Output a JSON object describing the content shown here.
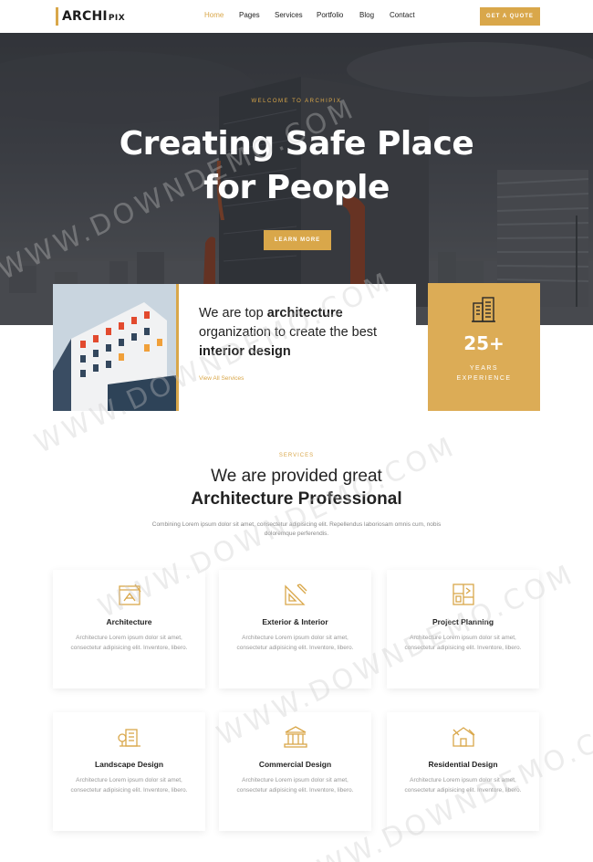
{
  "brand": {
    "name_main": "ARCHI",
    "name_sub": "PIX"
  },
  "nav": {
    "items": [
      {
        "label": "Home",
        "active": true
      },
      {
        "label": "Pages",
        "active": false
      },
      {
        "label": "Services",
        "active": false
      },
      {
        "label": "Portfolio",
        "active": false
      },
      {
        "label": "Blog",
        "active": false
      },
      {
        "label": "Contact",
        "active": false
      }
    ],
    "cta_label": "GET A QUOTE"
  },
  "hero": {
    "kicker": "WELCOME TO ARCHIPIX",
    "title_line1": "Creating Safe Place",
    "title_line2": "for People",
    "button_label": "LEARN MORE"
  },
  "about": {
    "text_plain1": "We are top ",
    "text_bold1": "architecture",
    "text_plain2": " organization to create the best ",
    "text_bold2": "interior design",
    "link_label": "View All Services"
  },
  "experience": {
    "number": "25+",
    "label_line1": "YEARS",
    "label_line2": "EXPERIENCE",
    "icon": "buildings-icon"
  },
  "services": {
    "kicker": "SERVICES",
    "title_line1": "We are provided great",
    "title_line2": "Architecture Professional",
    "description": "Combining Lorem ipsum dolor sit amet, consectetur adipisicing elit. Repellendus laboriosam omnis cum, nobis doloremque perferendis.",
    "cards": [
      {
        "title": "Architecture",
        "text": "Architecture Lorem ipsum dolor sit amet, consectetur adipisicing elit. Inventore, libero.",
        "icon": "drafting-icon"
      },
      {
        "title": "Exterior & Interior",
        "text": "Architecture Lorem ipsum dolor sit amet, consectetur adipisicing elit. Inventore, libero.",
        "icon": "ruler-pencil-icon"
      },
      {
        "title": "Project Planning",
        "text": "Architecture Lorem ipsum dolor sit amet, consectetur adipisicing elit. Inventore, libero.",
        "icon": "blueprint-icon"
      },
      {
        "title": "Landscape Design",
        "text": "Architecture Lorem ipsum dolor sit amet, consectetur adipisicing elit. Inventore, libero.",
        "icon": "landscape-icon"
      },
      {
        "title": "Commercial Design",
        "text": "Architecture Lorem ipsum dolor sit amet, consectetur adipisicing elit. Inventore, libero.",
        "icon": "bank-building-icon"
      },
      {
        "title": "Residential Design",
        "text": "Architecture Lorem ipsum dolor sit amet, consectetur adipisicing elit. Inventore, libero.",
        "icon": "house-plan-icon"
      }
    ]
  },
  "watermark": "WWW.DOWNDEMO.COM",
  "colors": {
    "accent": "#d9a74a",
    "text": "#222222",
    "muted": "#999999"
  }
}
